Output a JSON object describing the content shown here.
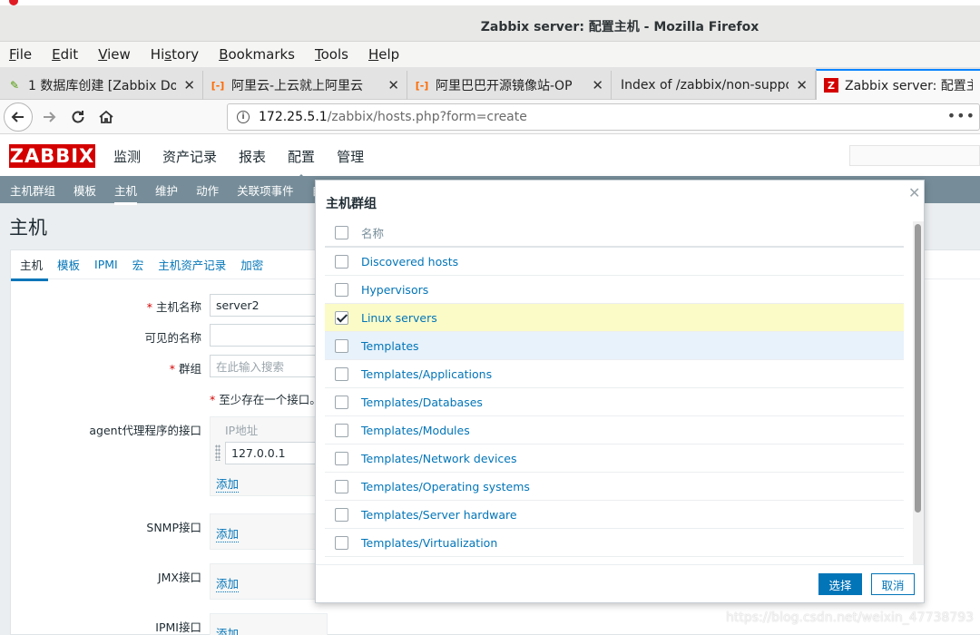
{
  "window": {
    "title": "Zabbix server: 配置主机 - Mozilla Firefox"
  },
  "menu": [
    {
      "pre": "",
      "ul": "F",
      "post": "ile"
    },
    {
      "pre": "",
      "ul": "E",
      "post": "dit"
    },
    {
      "pre": "",
      "ul": "V",
      "post": "iew"
    },
    {
      "pre": "Hi",
      "ul": "s",
      "post": "tory"
    },
    {
      "pre": "",
      "ul": "B",
      "post": "ookmarks"
    },
    {
      "pre": "",
      "ul": "T",
      "post": "ools"
    },
    {
      "pre": "",
      "ul": "H",
      "post": "elp"
    }
  ],
  "tabs": [
    {
      "label": "1 数据库创建 [Zabbix Doc",
      "icon": "doc-icon",
      "glyph": "✎"
    },
    {
      "label": "阿里云-上云就上阿里云",
      "icon": "aliyun-icon",
      "glyph": "[-]"
    },
    {
      "label": "阿里巴巴开源镜像站-OP",
      "icon": "aliyun-icon",
      "glyph": "[-]"
    },
    {
      "label": "Index of /zabbix/non-support",
      "icon": "",
      "glyph": ""
    },
    {
      "label": "Zabbix server: 配置主机",
      "icon": "zabbix-icon",
      "glyph": "Z"
    }
  ],
  "url": {
    "host": "172.25.5.1",
    "path": "/zabbix/hosts.php?form=create"
  },
  "zabbix": {
    "logo": "ZABBIX",
    "topnav": [
      "监测",
      "资产记录",
      "报表",
      "配置",
      "管理"
    ],
    "subnav": [
      "主机群组",
      "模板",
      "主机",
      "维护",
      "动作",
      "关联项事件",
      "自"
    ],
    "page_title": "主机",
    "form_tabs": [
      "主机",
      "模板",
      "IPMI",
      "宏",
      "主机资产记录",
      "加密"
    ]
  },
  "form": {
    "host_name_label": "主机名称",
    "host_name_value": "server2",
    "visible_name_label": "可见的名称",
    "groups_label": "群组",
    "groups_placeholder": "在此输入搜索",
    "interface_note": "至少存在一个接口。",
    "agent_label": "agent代理程序的接口",
    "ip_header": "IP地址",
    "ip_value": "127.0.0.1",
    "add_label": "添加",
    "snmp_label": "SNMP接口",
    "jmx_label": "JMX接口",
    "ipmi_label": "IPMI接口"
  },
  "dialog": {
    "title": "主机群组",
    "column_name": "名称",
    "items": [
      {
        "label": "Discovered hosts",
        "checked": false
      },
      {
        "label": "Hypervisors",
        "checked": false
      },
      {
        "label": "Linux servers",
        "checked": true
      },
      {
        "label": "Templates",
        "checked": false
      },
      {
        "label": "Templates/Applications",
        "checked": false
      },
      {
        "label": "Templates/Databases",
        "checked": false
      },
      {
        "label": "Templates/Modules",
        "checked": false
      },
      {
        "label": "Templates/Network devices",
        "checked": false
      },
      {
        "label": "Templates/Operating systems",
        "checked": false
      },
      {
        "label": "Templates/Server hardware",
        "checked": false
      },
      {
        "label": "Templates/Virtualization",
        "checked": false
      }
    ],
    "select_label": "选择",
    "cancel_label": "取消"
  },
  "watermark": "https://blog.csdn.net/weixin_47738793",
  "colors": {
    "zabbix_red": "#d40000",
    "link_blue": "#0275b8",
    "subnav_gray": "#768d99",
    "checked_row": "#fbfbc8"
  }
}
